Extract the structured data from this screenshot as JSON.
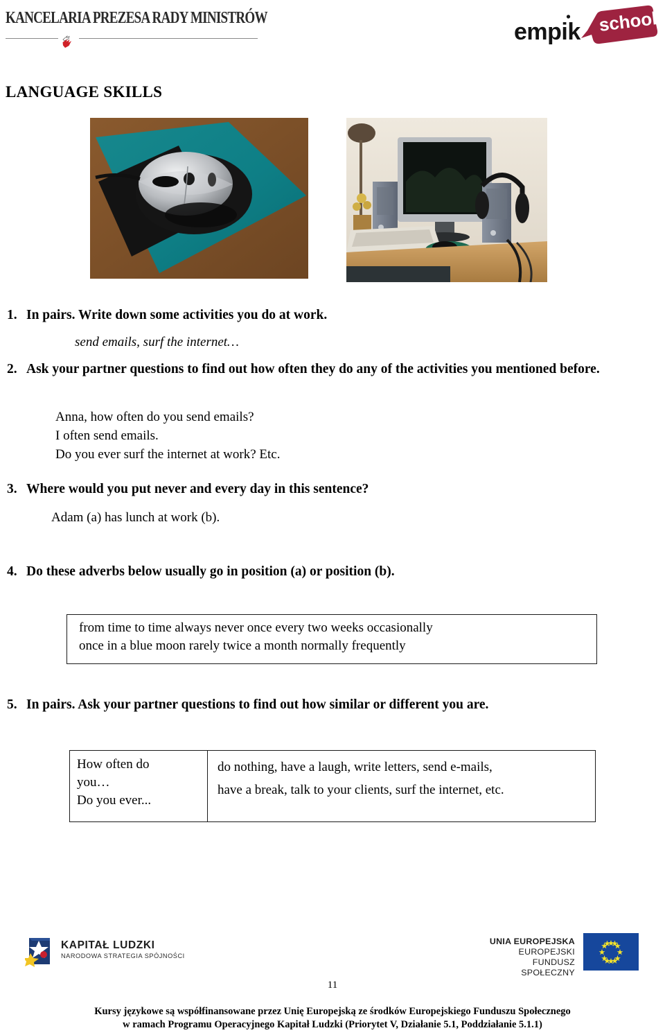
{
  "header": {
    "org_title": "KANCELARIA PREZESA RADY MINISTRÓW",
    "emblem_name": "polish-eagle-emblem",
    "brand": {
      "word_mark": "empik",
      "bubble_text": "school",
      "bubble_color": "#9e2340"
    }
  },
  "page_title": "LANGUAGE SKILLS",
  "photos": [
    {
      "name": "computer-mouse-on-mousepad",
      "alt": "A silver and black computer mouse sitting on a teal mousepad on a wooden desk"
    },
    {
      "name": "desktop-computer-workstation",
      "alt": "A desk with a flat-screen monitor, two speakers, headphones and a keyboard"
    }
  ],
  "exercises": [
    {
      "number": "1.",
      "prompt": "In pairs. Write down some activities you do at work.",
      "example": "send emails, surf the internet…"
    },
    {
      "number": "2.",
      "prompt": "Ask your partner questions to find out how often they do any of the activities you mentioned before.",
      "dialogue": [
        "Anna, how often do you send emails?",
        "I often send emails.",
        "Do you ever surf the internet at work? Etc."
      ]
    },
    {
      "number": "3.",
      "prompt": "Where would you put never and every day in this sentence?",
      "example": "Adam (a) has lunch at work (b)."
    },
    {
      "number": "4.",
      "prompt": "Do these adverbs below usually go in position (a) or position (b)."
    },
    {
      "number": "5.",
      "prompt": "In pairs. Ask your partner questions to find out how similar or different you are."
    }
  ],
  "adverb_box": {
    "line1": "from time to time    always    never    once every two  weeks    occasionally",
    "line2": "once in a blue moon    rarely    twice a month  normally    frequently"
  },
  "prompt_table": {
    "left_lines": [
      "How often do",
      "you…",
      "Do you ever..."
    ],
    "right_lines": [
      "do nothing, have a laugh,  write letters, send e-mails,",
      "have a break, talk to your clients, surf the internet, etc."
    ]
  },
  "footer": {
    "kapital_ludzki": {
      "main": "KAPITAŁ LUDZKI",
      "sub": "NARODOWA STRATEGIA SPÓJNOŚCI",
      "mark_name": "kapital-ludzki-logo"
    },
    "unia_europejska": {
      "line1": "UNIA EUROPEJSKA",
      "line2": "EUROPEJSKI",
      "line3": "FUNDUSZ SPOŁECZNY",
      "flag_name": "european-union-flag"
    },
    "page_number": "11",
    "note_line1": "Kursy językowe są współfinansowane przez Unię Europejską ze środków Europejskiego Funduszu Społecznego",
    "note_line2": "w ramach Programu Operacyjnego Kapitał Ludzki (Priorytet V, Działanie 5.1, Poddziałanie 5.1.1)"
  }
}
